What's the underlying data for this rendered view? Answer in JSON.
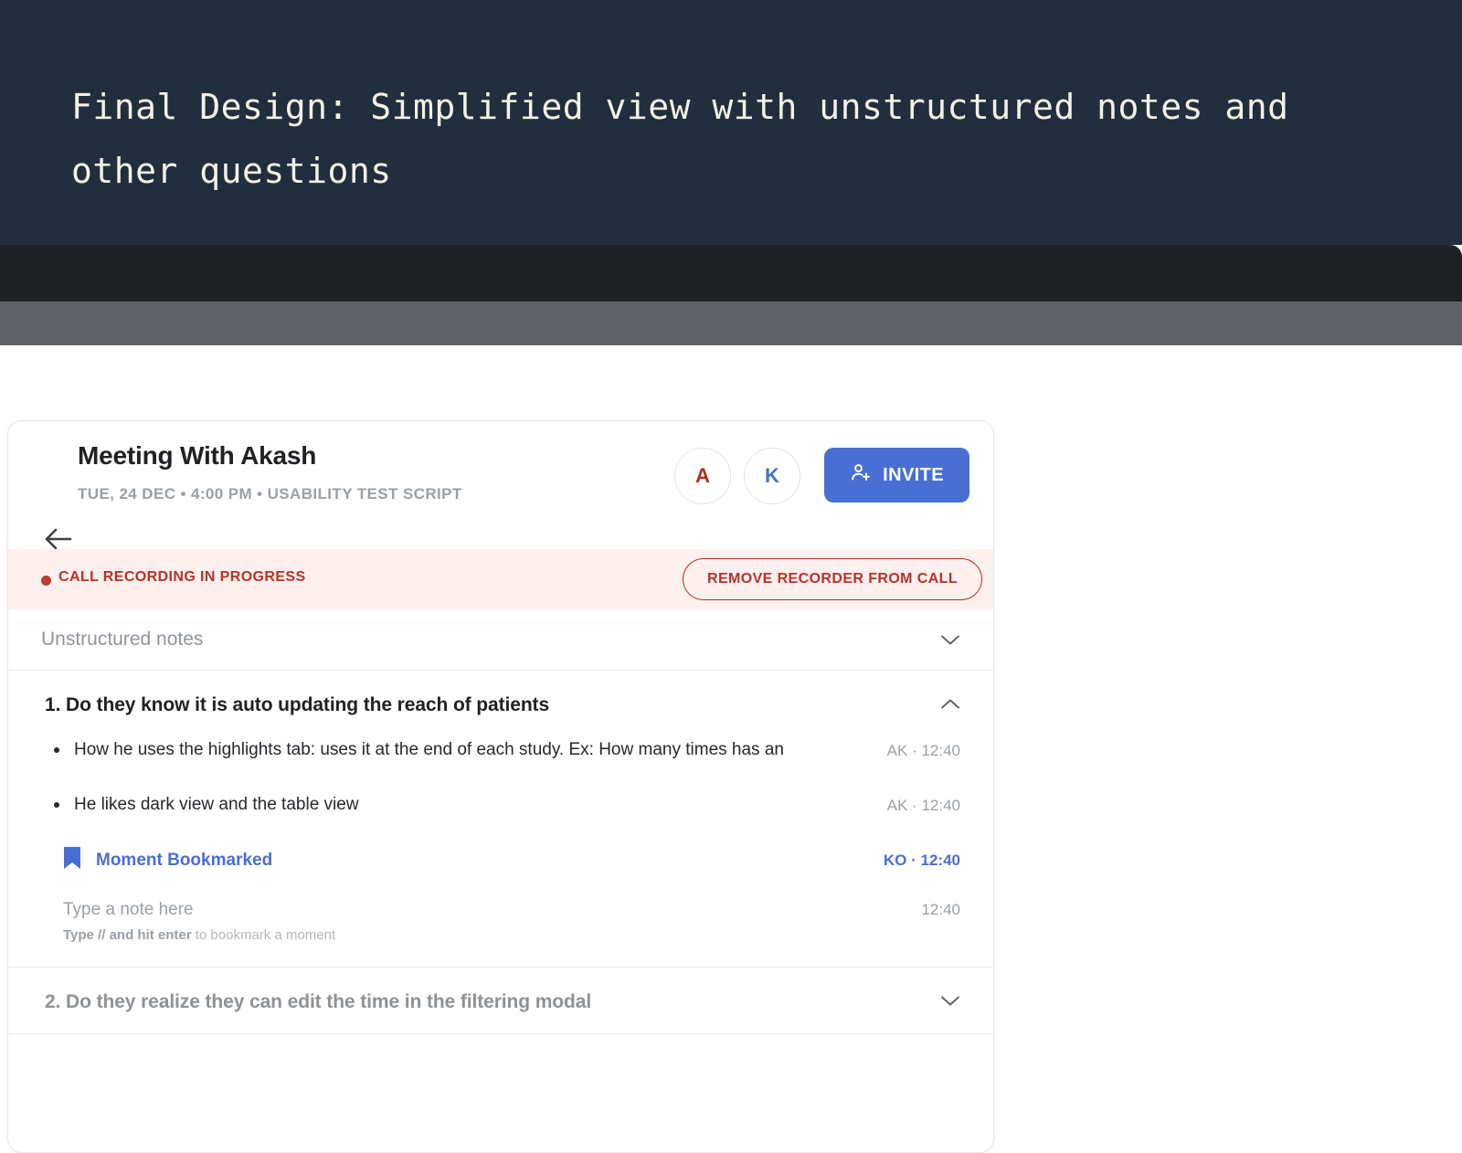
{
  "slide": {
    "title": "Final Design: Simplified view with unstructured notes and other questions",
    "background_color": "#222d3d",
    "text_color": "#f3f2e7"
  },
  "browser": {
    "star_icon": "star-icon",
    "profile_icon": "profile-avatar-photo",
    "menu_icon": "kebab-menu-icon"
  },
  "card": {
    "back_icon": "back-arrow-icon",
    "title": "Meeting With Akash",
    "subtitle": "TUE, 24 DEC • 4:00 PM • USABILITY TEST SCRIPT",
    "participants": [
      {
        "initial": "A",
        "color": "#b02a1e"
      },
      {
        "initial": "K",
        "color": "#4a73cc"
      }
    ],
    "invite_button": {
      "label": "INVITE",
      "icon": "person-add-icon",
      "color": "#4a6fd4"
    },
    "recording_banner": {
      "status_label": "CALL RECORDING IN PROGRESS",
      "dot_color": "#c0392b",
      "background_color": "#fdf0ef",
      "text_color": "#b83227",
      "action_label": "REMOVE RECORDER  FROM CALL"
    },
    "notes_section": {
      "label": "Unstructured notes",
      "chevron": "chevron-down-icon"
    },
    "questions": [
      {
        "text": "1. Do they know it is auto updating the reach of patients",
        "expanded": true,
        "chevron": "chevron-up-icon",
        "answers": [
          {
            "type": "bullet",
            "text": "How he uses the highlights tab: uses it at the end of each study. Ex: How many times has an",
            "author": "AK",
            "time": "12:40",
            "meta": "AK · 12:40"
          },
          {
            "type": "bullet",
            "text": "He likes dark view and the table view",
            "author": "AK",
            "time": "12:40",
            "meta": "AK · 12:40"
          }
        ],
        "bookmark": {
          "icon": "bookmark-icon",
          "label": "Moment Bookmarked",
          "meta": "KO · 12:40",
          "color": "#4a6fd4"
        },
        "note_input": {
          "placeholder": "Type a note here",
          "time": "12:40",
          "hint_bold": "Type // and hit enter",
          "hint_rest": " to bookmark a moment"
        }
      },
      {
        "text": "2. Do they realize they can edit the time in the filtering modal",
        "expanded": false,
        "chevron": "chevron-down-icon"
      }
    ]
  }
}
